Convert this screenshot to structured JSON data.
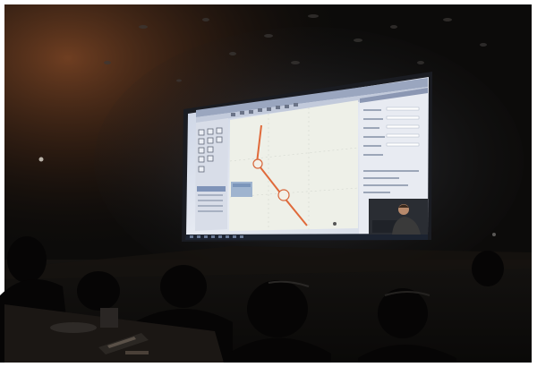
{
  "scene": {
    "photo_frame_color": "#ffffff",
    "auditorium_color": "#0c0b0a",
    "ceiling_color": "#121010",
    "warm_light_color": "#6a3a1e",
    "screen_bezel_color": "#1a1c22",
    "screen_glow_color": "#dfe4ef",
    "canvas_color": "#eef0e8",
    "route_line_color": "#e06a3a",
    "presenter_shirt_color": "#3a3a3a"
  },
  "projected_app": {
    "menu_bar": "",
    "toolbar_icons": [
      "select-icon",
      "pan-icon",
      "zoom-icon",
      "node-icon",
      "line-icon",
      "polygon-icon",
      "measure-icon",
      "save-icon"
    ],
    "taskbar_icons": [
      "start-icon",
      "search-icon",
      "task-view-icon",
      "browser-icon",
      "folder-icon",
      "app-icon",
      "app-icon",
      "app-icon"
    ]
  }
}
